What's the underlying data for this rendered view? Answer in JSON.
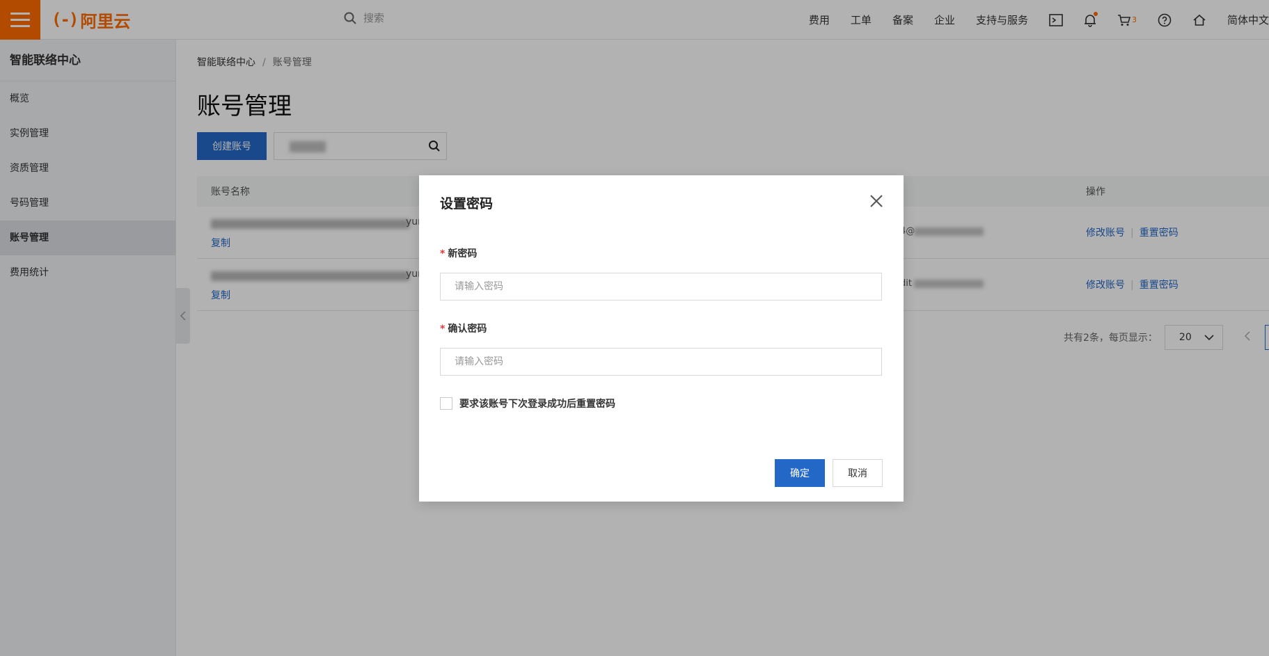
{
  "topbar": {
    "logo_text": "阿里云",
    "logo_mark": "(-)",
    "search_placeholder": "搜索",
    "nav": [
      "费用",
      "工单",
      "备案",
      "企业",
      "支持与服务"
    ],
    "cart_count": "3",
    "language": "简体中文"
  },
  "sidebar": {
    "title": "智能联络中心",
    "items": [
      {
        "label": "概览",
        "active": false
      },
      {
        "label": "实例管理",
        "active": false
      },
      {
        "label": "资质管理",
        "active": false
      },
      {
        "label": "号码管理",
        "active": false
      },
      {
        "label": "账号管理",
        "active": true
      },
      {
        "label": "费用统计",
        "active": false
      }
    ]
  },
  "main": {
    "breadcrumb": [
      "智能联络中心",
      "/",
      "账号管理"
    ],
    "title": "账号管理",
    "create_button": "创建账号",
    "table": {
      "columns": [
        "账号名称",
        "操作"
      ],
      "rows": [
        {
          "name_suffix": "yun",
          "copy": "复制",
          "mid_text": "4@",
          "op_edit": "修改账号",
          "op_reset": "重置密码"
        },
        {
          "name_suffix": "yun",
          "copy": "复制",
          "mid_text": "dit",
          "op_edit": "修改账号",
          "op_reset": "重置密码"
        }
      ]
    },
    "pagination": {
      "summary": "共有2条，每页显示：",
      "page_size": "20"
    }
  },
  "dialog": {
    "title": "设置密码",
    "new_password_label": "新密码",
    "new_password_placeholder": "请输入密码",
    "confirm_password_label": "确认密码",
    "confirm_password_placeholder": "请输入密码",
    "required_mark": "*",
    "checkbox_label": "要求该账号下次登录成功后重置密码",
    "ok_button": "确定",
    "cancel_button": "取消"
  },
  "colors": {
    "brand": "#ff6a00",
    "primary": "#2468c7"
  }
}
